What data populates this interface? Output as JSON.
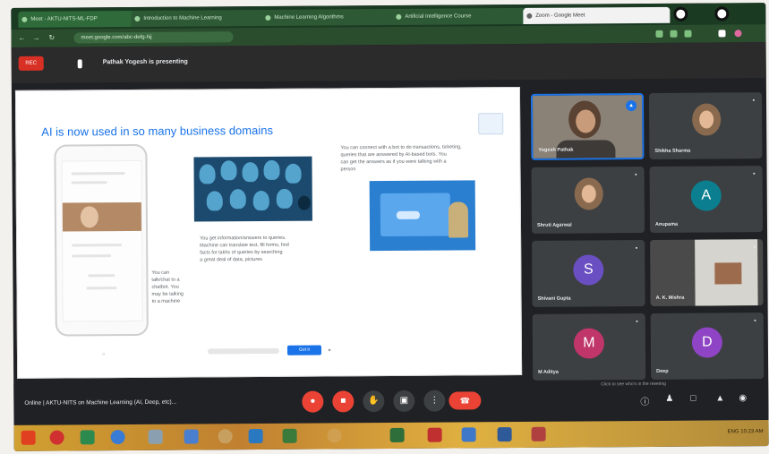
{
  "browser": {
    "tabs": [
      {
        "label": "Meet - AKTU-NITS-ML-FDP"
      },
      {
        "label": "Introduction to Machine Learning"
      },
      {
        "label": "Machine Learning Algorithms"
      },
      {
        "label": "Artificial Intelligence Course"
      },
      {
        "label": "Zoom - Google Meet"
      }
    ],
    "address": "meet.google.com/abc-defg-hij"
  },
  "meet": {
    "record_label": "REC",
    "presenter_banner": "Pathak Yogesh is presenting",
    "slide": {
      "title": "AI is now used in so many business domains",
      "caption_phone": "You can\ntalk/chat to a\nchatbot. You\nmay be talking\nto a machine",
      "caption_robots": "You get information/answers to queries.\nMachine can translate text, fill forms, find\nfacts for lakhs of queries by searching\na great deal of data, pictures",
      "caption_chat": "You can connect with a bot to do transactions, ticketing,\nqueries that are answered by AI-based bots. You\ncan get the answers as if you were talking with a\nperson",
      "control_button": "Got it"
    },
    "participants": [
      {
        "name": "Yogesh Pathak",
        "type": "camera",
        "presenting": true
      },
      {
        "name": "Shikha Sharma",
        "type": "photo"
      },
      {
        "name": "Anupama",
        "type": "avatar",
        "initial": "A",
        "color": "#0b7f8f"
      },
      {
        "name": "Shruti Agarwal",
        "type": "photo"
      },
      {
        "name": "Shivani Gupta",
        "type": "avatar",
        "initial": "S",
        "color": "#6a4fc2"
      },
      {
        "name": "A. K. Mishra",
        "type": "room"
      },
      {
        "name": "M Aditya",
        "type": "avatar",
        "initial": "M",
        "color": "#c0356a"
      },
      {
        "name": "Deep",
        "type": "avatar",
        "initial": "D",
        "color": "#8e44c4"
      }
    ],
    "meeting_title": "Online | AKTU-NITS on Machine Learning (AI, Deep, etc)...",
    "notice": "Click to see who's in the meeting"
  },
  "taskbar": {
    "tray": "ENG 10:23 AM"
  }
}
